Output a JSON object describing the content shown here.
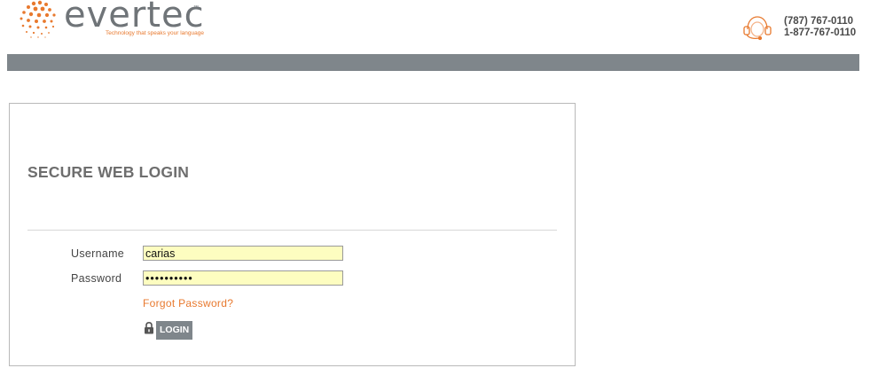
{
  "header": {
    "logo_text": "evertec",
    "logo_tm": "™",
    "tagline": "Technology that speaks your language",
    "phone_local": "(787) 767-0110",
    "phone_tollfree": "1-877-767-0110",
    "accent_color": "#e8792e",
    "bar_color": "#7f868b"
  },
  "login": {
    "title": "SECURE WEB LOGIN",
    "username_label": "Username",
    "username_value": "carias",
    "password_label": "Password",
    "password_value": "••••••••••",
    "forgot_link": "Forgot Password?",
    "login_button": "LOGIN",
    "input_bg_color": "#fdfdc0"
  },
  "icons": {
    "logo": "sunburst-dots-icon",
    "support": "headset-icon",
    "lock": "lock-icon"
  }
}
